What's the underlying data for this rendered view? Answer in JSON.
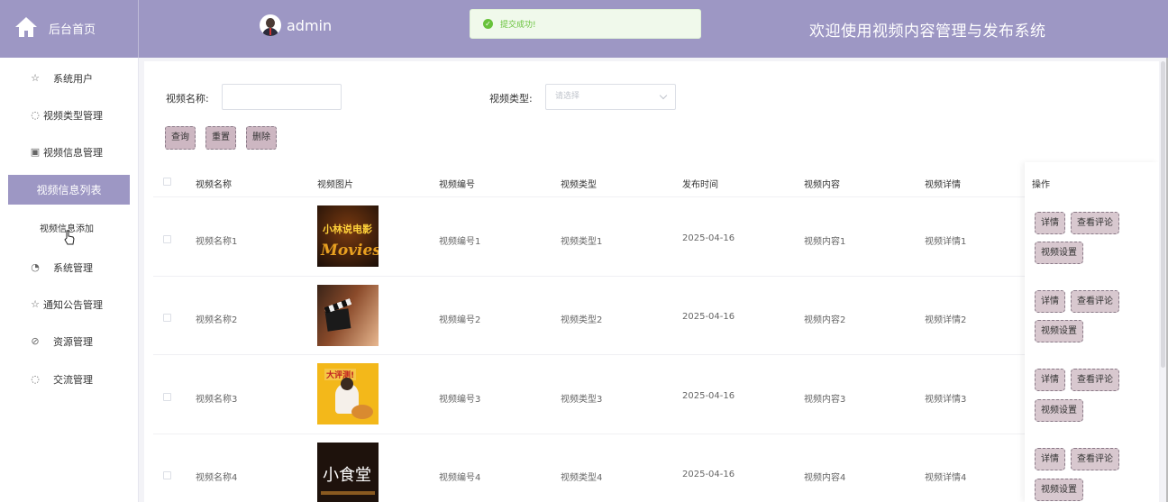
{
  "header": {
    "brand_label": "后台首页",
    "username": "admin",
    "site_title": "欢迎使用视频内容管理与发布系统"
  },
  "toast": {
    "text": "提交成功!",
    "icon": "check-circle-icon",
    "color": "#67c23a"
  },
  "sidebar": {
    "items": [
      {
        "label": "系统用户",
        "icon": "star-icon"
      },
      {
        "label": "视频类型管理",
        "icon": "drop-icon"
      },
      {
        "label": "视频信息管理",
        "icon": "trash-icon"
      },
      {
        "label": "系统管理",
        "icon": "cycle-icon"
      },
      {
        "label": "通知公告管理",
        "icon": "star-outline-icon"
      },
      {
        "label": "资源管理",
        "icon": "compass-icon"
      },
      {
        "label": "交流管理",
        "icon": "drop-outline-icon"
      }
    ],
    "active_label": "视频信息列表",
    "sub_label": "视频信息添加"
  },
  "filters": {
    "name_label": "视频名称:",
    "type_label": "视频类型:",
    "type_placeholder": "请选择"
  },
  "buttons": {
    "query": "查询",
    "reset": "重置",
    "delete": "删除"
  },
  "table": {
    "headers": [
      "视频名称",
      "视频图片",
      "视频编号",
      "视频类型",
      "发布时间",
      "视频内容",
      "视频详情",
      "操作"
    ],
    "rows": [
      {
        "name": "视频名称1",
        "code": "视频编号1",
        "type": "视频类型1",
        "date": "2025-04-16",
        "content": "视频内容1",
        "detail": "视频详情1",
        "thumb_text": "小林说电影",
        "thumb_sub": "Movies"
      },
      {
        "name": "视频名称2",
        "code": "视频编号2",
        "type": "视频类型2",
        "date": "2025-04-16",
        "content": "视频内容2",
        "detail": "视频详情2",
        "thumb_text": "",
        "thumb_sub": ""
      },
      {
        "name": "视频名称3",
        "code": "视频编号3",
        "type": "视频类型3",
        "date": "2025-04-16",
        "content": "视频内容3",
        "detail": "视频详情3",
        "thumb_text": "大评测!",
        "thumb_sub": ""
      },
      {
        "name": "视频名称4",
        "code": "视频编号4",
        "type": "视频类型4",
        "date": "2025-04-16",
        "content": "视频内容4",
        "detail": "视频详情4",
        "thumb_text": "小食堂",
        "thumb_sub": ""
      }
    ],
    "row_actions": {
      "detail": "详情",
      "comments": "查看评论",
      "settings": "视频设置"
    }
  },
  "colors": {
    "primary": "#9d97c4",
    "button": "#cdb7c2"
  }
}
